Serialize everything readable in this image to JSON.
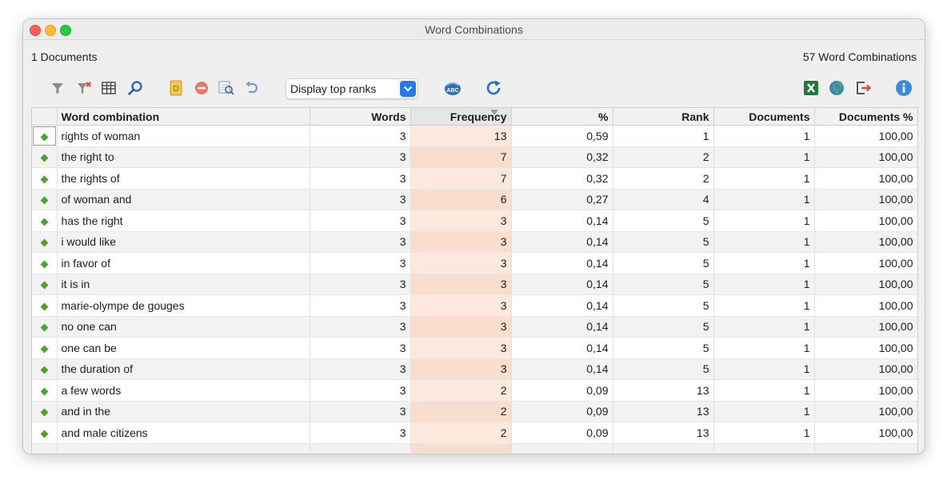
{
  "window": {
    "title": "Word Combinations"
  },
  "info": {
    "documents": "1 Documents",
    "combinations": "57 Word Combinations"
  },
  "toolbar": {
    "dropdown_value": "Display top ranks",
    "icons": [
      "filter-icon",
      "clear-filter-icon",
      "columns-icon",
      "search-icon",
      "document-icon",
      "remove-icon",
      "search-results-icon",
      "undo-icon",
      "spellcheck-icon",
      "refresh-icon",
      "excel-export-icon",
      "web-export-icon",
      "export-icon",
      "info-icon"
    ]
  },
  "table": {
    "columns": [
      "",
      "Word combination",
      "Words",
      "Frequency",
      "%",
      "Rank",
      "Documents",
      "Documents %"
    ],
    "rows": [
      {
        "combo": "rights of woman",
        "words": "3",
        "freq": "13",
        "pct": "0,59",
        "rank": "1",
        "docs": "1",
        "docs_pct": "100,00"
      },
      {
        "combo": "the right to",
        "words": "3",
        "freq": "7",
        "pct": "0,32",
        "rank": "2",
        "docs": "1",
        "docs_pct": "100,00"
      },
      {
        "combo": "the rights of",
        "words": "3",
        "freq": "7",
        "pct": "0,32",
        "rank": "2",
        "docs": "1",
        "docs_pct": "100,00"
      },
      {
        "combo": "of woman and",
        "words": "3",
        "freq": "6",
        "pct": "0,27",
        "rank": "4",
        "docs": "1",
        "docs_pct": "100,00"
      },
      {
        "combo": "has the right",
        "words": "3",
        "freq": "3",
        "pct": "0,14",
        "rank": "5",
        "docs": "1",
        "docs_pct": "100,00"
      },
      {
        "combo": "i would like",
        "words": "3",
        "freq": "3",
        "pct": "0,14",
        "rank": "5",
        "docs": "1",
        "docs_pct": "100,00"
      },
      {
        "combo": "in favor of",
        "words": "3",
        "freq": "3",
        "pct": "0,14",
        "rank": "5",
        "docs": "1",
        "docs_pct": "100,00"
      },
      {
        "combo": "it is in",
        "words": "3",
        "freq": "3",
        "pct": "0,14",
        "rank": "5",
        "docs": "1",
        "docs_pct": "100,00"
      },
      {
        "combo": "marie-olympe de gouges",
        "words": "3",
        "freq": "3",
        "pct": "0,14",
        "rank": "5",
        "docs": "1",
        "docs_pct": "100,00"
      },
      {
        "combo": "no one can",
        "words": "3",
        "freq": "3",
        "pct": "0,14",
        "rank": "5",
        "docs": "1",
        "docs_pct": "100,00"
      },
      {
        "combo": "one can be",
        "words": "3",
        "freq": "3",
        "pct": "0,14",
        "rank": "5",
        "docs": "1",
        "docs_pct": "100,00"
      },
      {
        "combo": "the duration of",
        "words": "3",
        "freq": "3",
        "pct": "0,14",
        "rank": "5",
        "docs": "1",
        "docs_pct": "100,00"
      },
      {
        "combo": "a few words",
        "words": "3",
        "freq": "2",
        "pct": "0,09",
        "rank": "13",
        "docs": "1",
        "docs_pct": "100,00"
      },
      {
        "combo": "and in the",
        "words": "3",
        "freq": "2",
        "pct": "0,09",
        "rank": "13",
        "docs": "1",
        "docs_pct": "100,00"
      },
      {
        "combo": "and male citizens",
        "words": "3",
        "freq": "2",
        "pct": "0,09",
        "rank": "13",
        "docs": "1",
        "docs_pct": "100,00"
      },
      {
        "combo": "",
        "words": "",
        "freq": "",
        "pct": "",
        "rank": "",
        "docs": "",
        "docs_pct": ""
      }
    ]
  },
  "colors": {
    "accent": "#1f7cf2",
    "diamond": "#48a52e",
    "freq_highlight": "#fde8de"
  }
}
